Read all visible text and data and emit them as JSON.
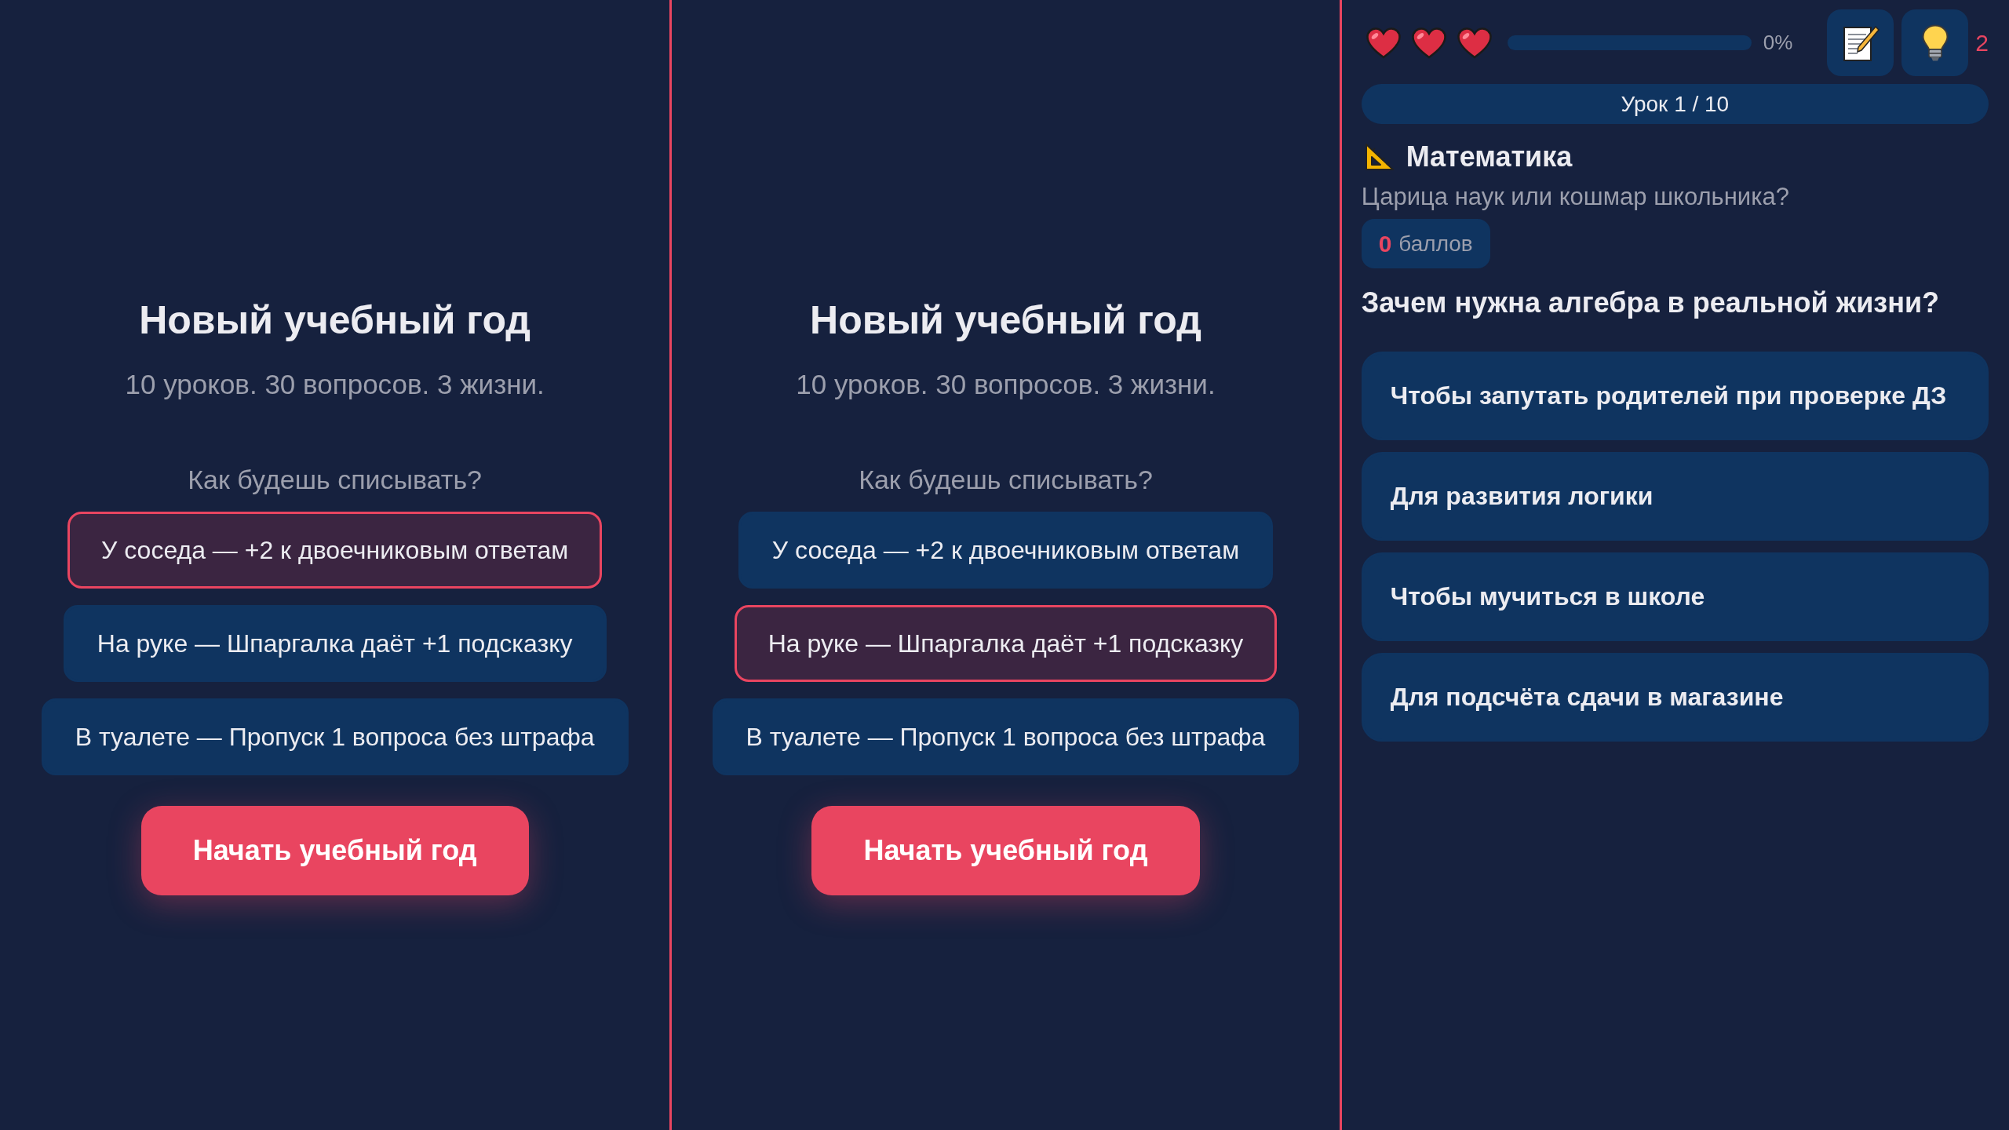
{
  "panels": [
    {
      "kind": "start",
      "title": "Новый учебный год",
      "subtitle": "10 уроков. 30 вопросов. 3 жизни.",
      "prompt": "Как будешь списывать?",
      "options": [
        {
          "label": "У соседа — +2 к двоечниковым ответам",
          "selected": true
        },
        {
          "label": "На руке — Шпаргалка даёт +1 подсказку",
          "selected": false
        },
        {
          "label": "В туалете — Пропуск 1 вопроса без штрафа",
          "selected": false
        }
      ],
      "start_button": "Начать учебный год"
    },
    {
      "kind": "start",
      "title": "Новый учебный год",
      "subtitle": "10 уроков. 30 вопросов. 3 жизни.",
      "prompt": "Как будешь списывать?",
      "options": [
        {
          "label": "У соседа — +2 к двоечниковым ответам",
          "selected": false
        },
        {
          "label": "На руке — Шпаргалка даёт +1 подсказку",
          "selected": true
        },
        {
          "label": "В туалете — Пропуск 1 вопроса без штрафа",
          "selected": false
        }
      ],
      "start_button": "Начать учебный год"
    },
    {
      "kind": "quiz",
      "hearts": [
        {
          "filled": true
        },
        {
          "filled": true
        },
        {
          "filled": true
        }
      ],
      "progress": {
        "reading": "0%"
      },
      "hint_count": "2",
      "lesson": "Урок 1 / 10",
      "subject": {
        "name": "Математика",
        "tagline": "Царица наук или кошмар школьника?"
      },
      "score": {
        "value": "0",
        "unit": "баллов"
      },
      "question": "Зачем нужна алгебра в реальной жизни?",
      "answers": [
        {
          "label": "Чтобы запутать родителей при проверке ДЗ",
          "selected": false
        },
        {
          "label": "Для развития логики",
          "selected": false
        },
        {
          "label": "Чтобы мучиться в школе",
          "selected": false
        },
        {
          "label": "Для подсчёта сдачи в магазине",
          "selected": false
        }
      ]
    }
  ]
}
